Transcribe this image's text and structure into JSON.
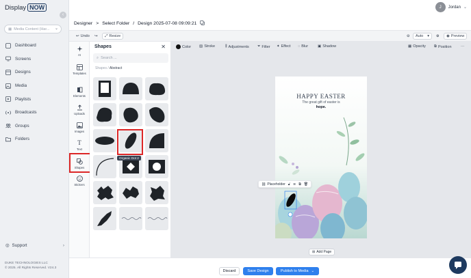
{
  "app": {
    "logo_text": "Display",
    "logo_badge": "NOW"
  },
  "sidebar": {
    "media_select": "Media Content (Har...",
    "items": [
      {
        "label": "Dashboard",
        "icon": "dashboard-icon"
      },
      {
        "label": "Screens",
        "icon": "screens-icon"
      },
      {
        "label": "Designs",
        "icon": "designs-icon"
      },
      {
        "label": "Media",
        "icon": "media-icon"
      },
      {
        "label": "Playlists",
        "icon": "playlists-icon"
      },
      {
        "label": "Broadcasts",
        "icon": "broadcasts-icon"
      },
      {
        "label": "Groups",
        "icon": "groups-icon"
      },
      {
        "label": "Folders",
        "icon": "folders-icon"
      }
    ],
    "support": "Support",
    "company": "DUKE TECHNOLOGIES LLC",
    "copyright": "© 2025. All Rights Reserved. V24.3"
  },
  "user": {
    "initial": "J",
    "name": "Jordan"
  },
  "breadcrumb": {
    "root": "Designer",
    "sep1": ">",
    "folder": "Select Folder",
    "sep2": "/",
    "design": "Design 2025-07-08 09:09:21"
  },
  "toolbar": {
    "undo": "Undo",
    "redo": "↪",
    "resize": "Resize",
    "zoom": "Auto",
    "preview": "Preview"
  },
  "rail": [
    {
      "label": "AI"
    },
    {
      "label": "Templates"
    },
    {
      "label": "Elements"
    },
    {
      "label": "Uploads"
    },
    {
      "label": "Images"
    },
    {
      "label": "Text"
    },
    {
      "label": "Shapes"
    },
    {
      "label": "Stickers"
    }
  ],
  "panel": {
    "title": "Shapes",
    "search_placeholder": "Search ...",
    "bc_root": "Shapes",
    "bc_sep": "/",
    "bc_current": "Abstract",
    "tooltip": "Organic Dot 2"
  },
  "props": {
    "color": "Color",
    "stroke": "Stroke",
    "adjustments": "Adjustments",
    "filter": "Filter",
    "effect": "Effect",
    "blur": "Blur",
    "shadow": "Shadow",
    "opacity": "Opacity",
    "position": "Position",
    "more": "···"
  },
  "artboard": {
    "title": "HAPPY EASTER",
    "line1": "The great gift of easter is",
    "line2": "hope."
  },
  "placeholder": {
    "label": "Placeholder"
  },
  "add_page": "Add Page",
  "bottom": {
    "discard": "Discard",
    "save": "Save Design",
    "publish": "Publish to Media"
  },
  "colors": {
    "primary": "#2f80ed",
    "highlight": "#dc2626",
    "navy": "#1e3a5f"
  }
}
